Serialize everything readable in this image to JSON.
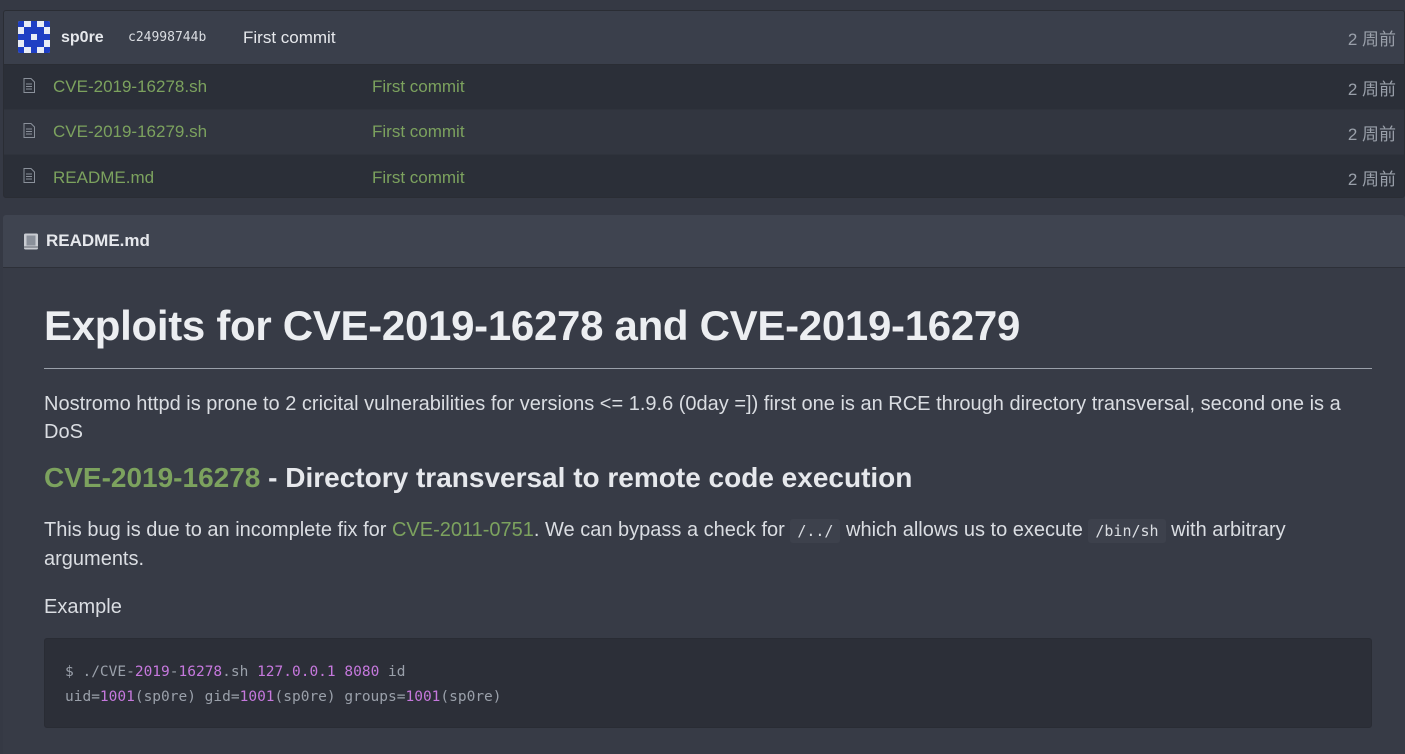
{
  "commit": {
    "author": "sp0re",
    "sha": "c24998744b",
    "message": "First commit",
    "time": "2 周前"
  },
  "files": [
    {
      "name": "CVE-2019-16278.sh",
      "commit": "First commit",
      "time": "2 周前"
    },
    {
      "name": "CVE-2019-16279.sh",
      "commit": "First commit",
      "time": "2 周前"
    },
    {
      "name": "README.md",
      "commit": "First commit",
      "time": "2 周前"
    }
  ],
  "readme": {
    "header": "README.md",
    "title": "Exploits for CVE-2019-16278 and CVE-2019-16279",
    "intro": "Nostromo httpd is prone to 2 cricital vulnerabilities for versions <= 1.9.6 (0day =]) first one is an RCE through directory transversal, second one is a DoS",
    "section_link": "CVE-2019-16278",
    "section_rest": " - Directory transversal to remote code execution",
    "bug_pre": "This bug is due to an incomplete fix for ",
    "bug_link": "CVE-2011-0751",
    "bug_mid1": ". We can bypass a check for ",
    "bug_code1": "/../",
    "bug_mid2": " which allows us to execute ",
    "bug_code2": "/bin/sh",
    "bug_post": " with arbitrary arguments.",
    "example_label": "Example",
    "code_line1": {
      "prompt": "$ ./CVE-",
      "n1": "2019",
      "t1": "-",
      "n2": "16278",
      "t2": ".sh ",
      "n3": "127.0.0.1",
      "t3": " ",
      "n4": "8080",
      "t4": " id"
    },
    "code_line2": {
      "a": "uid=",
      "n1": "1001",
      "b": "(sp0re) gid=",
      "n2": "1001",
      "c": "(sp0re) groups=",
      "n3": "1001",
      "d": "(sp0re)"
    }
  },
  "colors": {
    "link": "#7ca25e",
    "background": "#353944",
    "number": "#c678dd"
  }
}
